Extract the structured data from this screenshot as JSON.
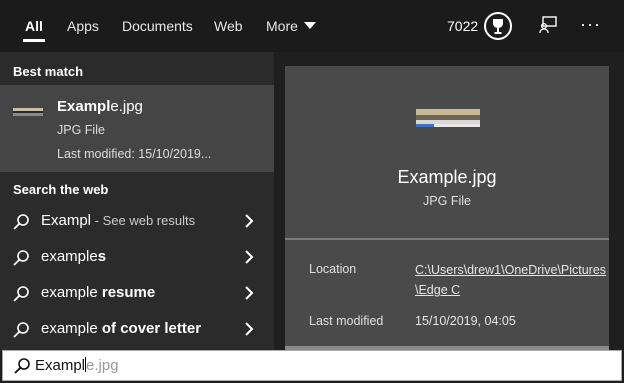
{
  "tabs": [
    {
      "label": "All",
      "active": true
    },
    {
      "label": "Apps",
      "active": false
    },
    {
      "label": "Documents",
      "active": false
    },
    {
      "label": "Web",
      "active": false
    },
    {
      "label": "More",
      "active": false
    }
  ],
  "header": {
    "points": "7022",
    "icons": [
      "trophy-icon",
      "feedback-icon",
      "more-options-icon"
    ],
    "ellipsis": "···"
  },
  "best_match": {
    "title": "Best match",
    "name_bold": "Exampl",
    "name_rest": "e.jpg",
    "type": "JPG File",
    "modified": "Last modified: 15/10/2019..."
  },
  "web": {
    "title": "Search the web",
    "items": [
      {
        "prefix": "Exampl",
        "bold": "",
        "hint": " - See web results"
      },
      {
        "prefix": "example",
        "bold": "s",
        "hint": ""
      },
      {
        "prefix": "example",
        "bold": " resume",
        "hint": ""
      },
      {
        "prefix": "example",
        "bold": " of cover letter",
        "hint": ""
      }
    ]
  },
  "preview": {
    "name": "Example.jpg",
    "type": "JPG File",
    "location_label": "Location",
    "location_value": "C:\\Users\\drew1\\OneDrive\\Pictures\\Edge C",
    "modified_label": "Last modified",
    "modified_value": "15/10/2019, 04:05"
  },
  "search": {
    "typed": "Exampl",
    "suggestion": "e.jpg"
  },
  "colors": {
    "background": "#1f1f1f",
    "pane": "#2b2b2b",
    "selected": "#454545",
    "preview": "#4a4a4a"
  }
}
